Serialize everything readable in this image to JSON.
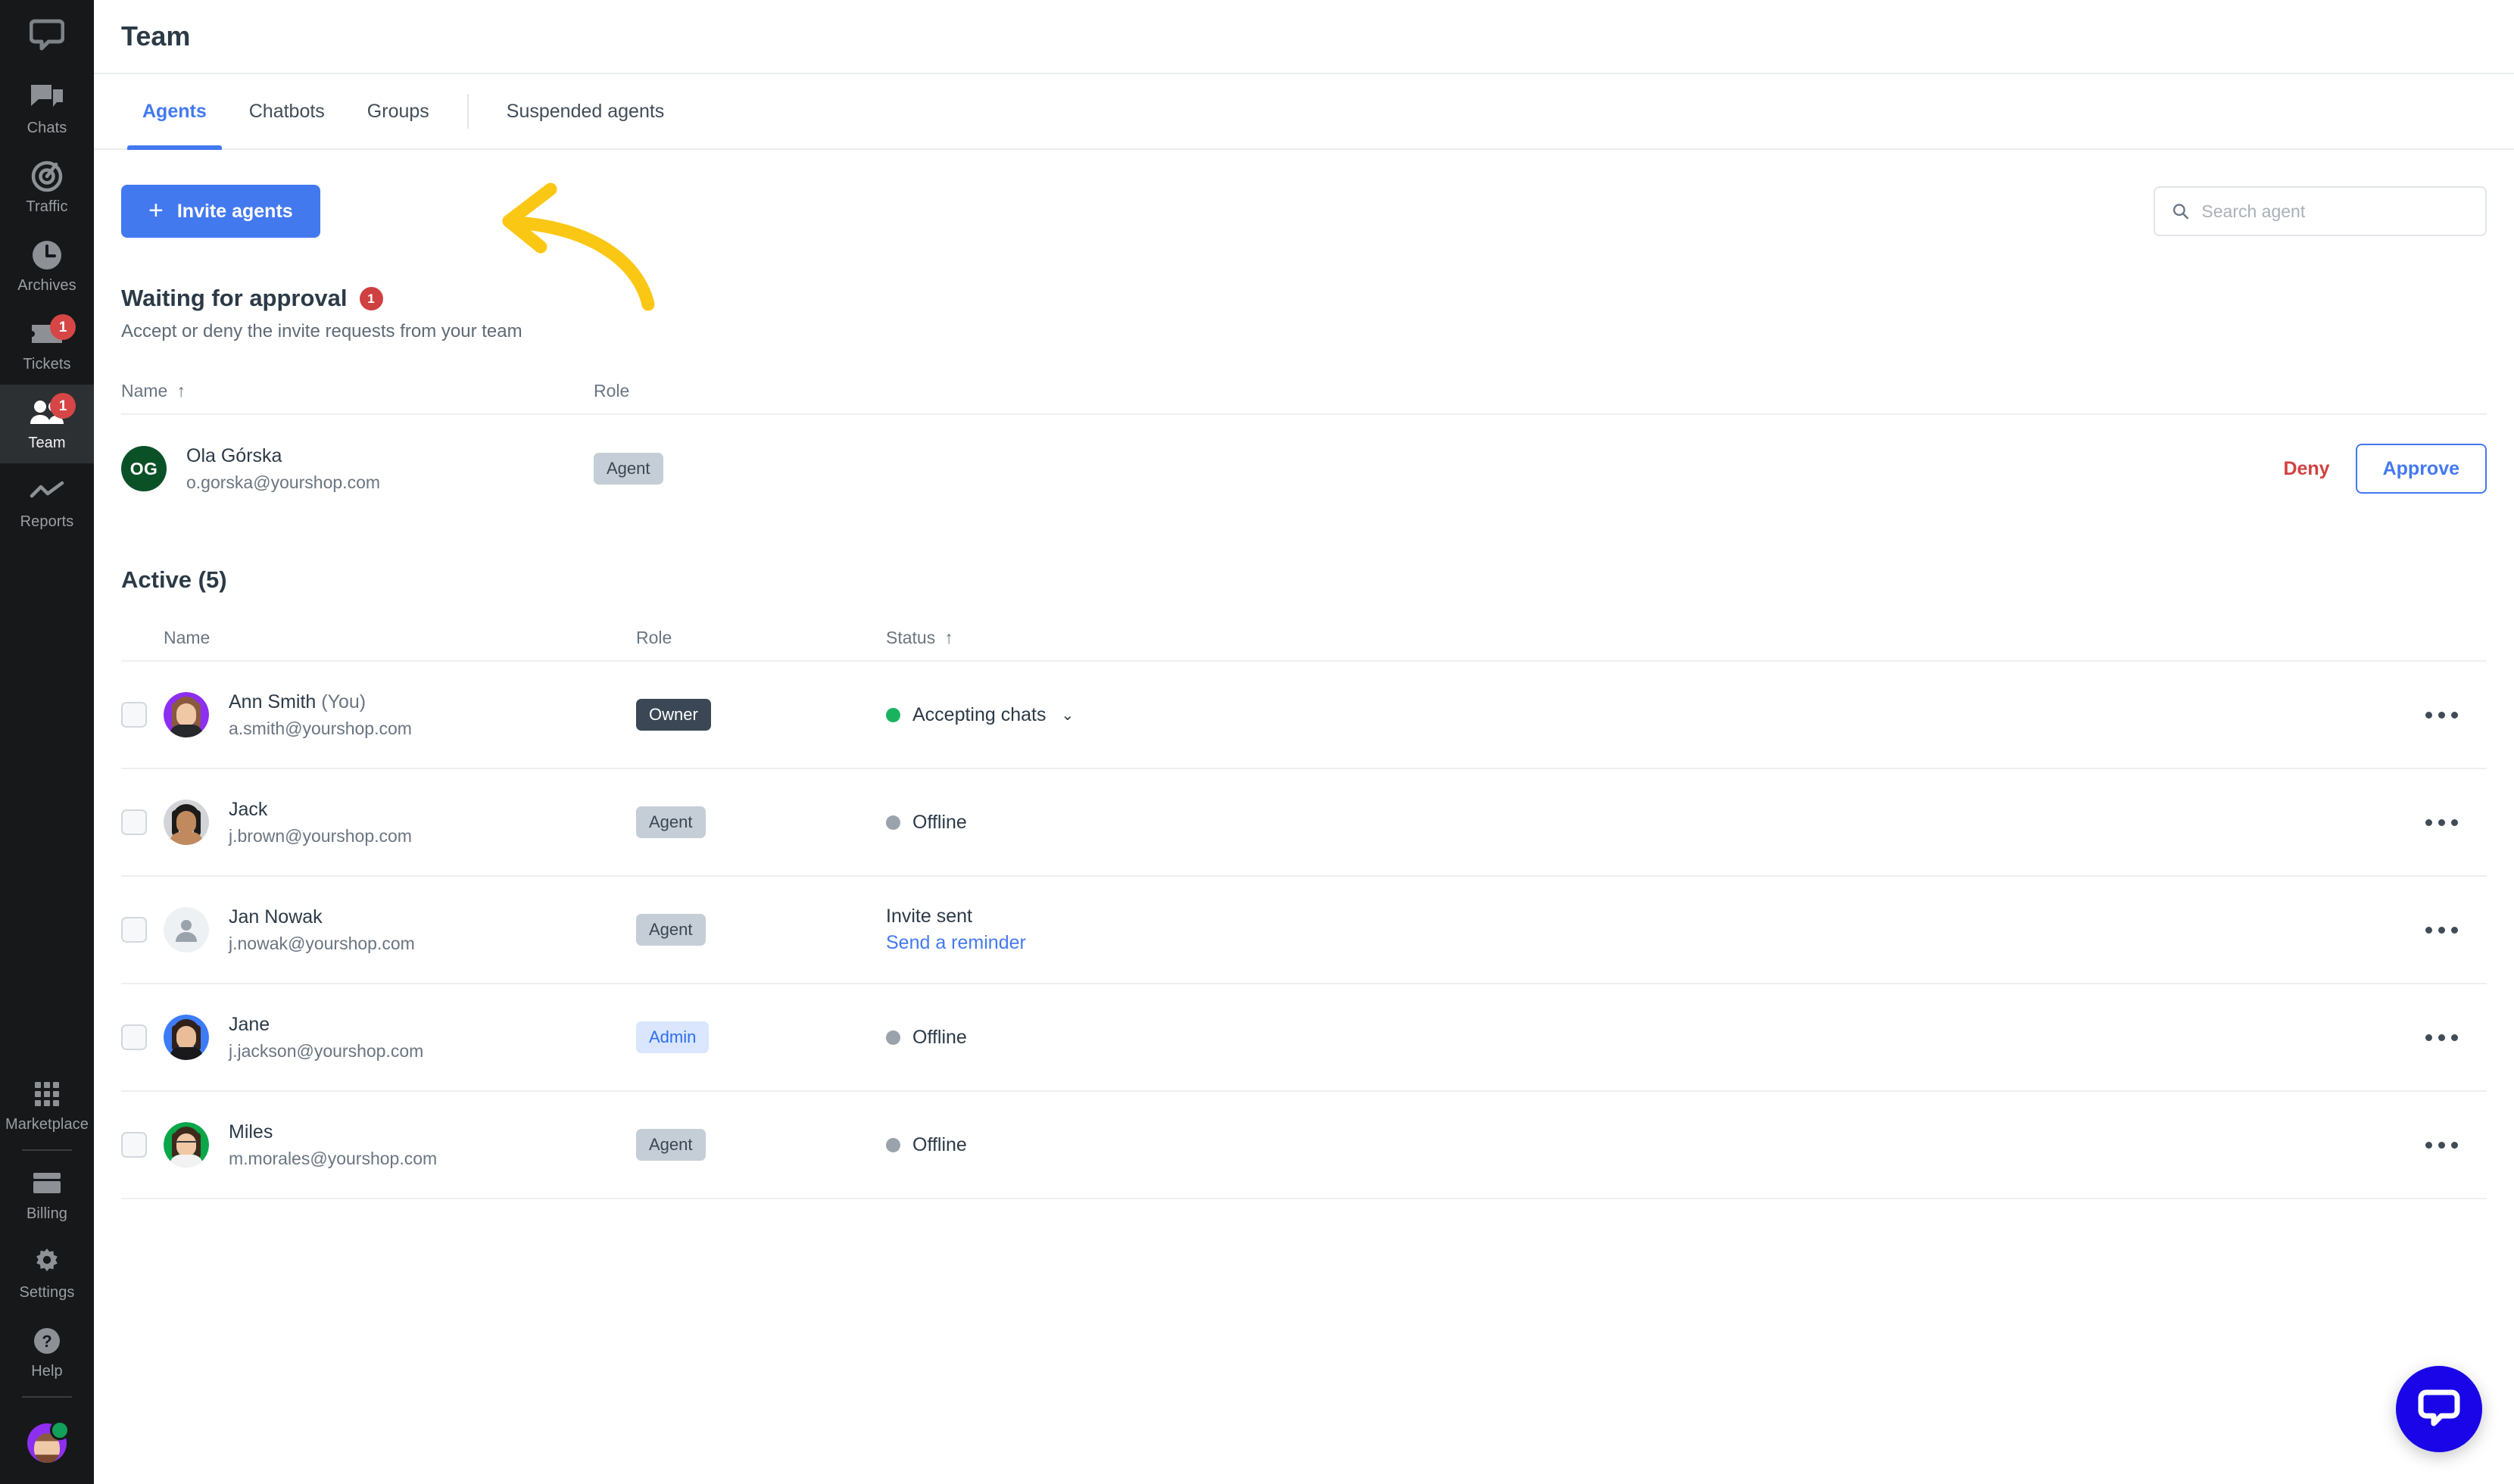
{
  "sidebar": {
    "logo_icon": "livechat-logo-icon",
    "items": [
      {
        "label": "Chats",
        "icon": "chats-icon",
        "badge": null,
        "active": false
      },
      {
        "label": "Traffic",
        "icon": "traffic-icon",
        "badge": null,
        "active": false
      },
      {
        "label": "Archives",
        "icon": "archives-icon",
        "badge": null,
        "active": false
      },
      {
        "label": "Tickets",
        "icon": "tickets-icon",
        "badge": "1",
        "active": false
      },
      {
        "label": "Team",
        "icon": "team-icon",
        "badge": "1",
        "active": true
      },
      {
        "label": "Reports",
        "icon": "reports-icon",
        "badge": null,
        "active": false
      }
    ],
    "bottom_items": [
      {
        "label": "Marketplace",
        "icon": "marketplace-icon"
      },
      {
        "label": "Billing",
        "icon": "billing-icon"
      },
      {
        "label": "Settings",
        "icon": "settings-gear-icon"
      },
      {
        "label": "Help",
        "icon": "help-question-icon"
      }
    ],
    "user_avatar": {
      "name": "user-avatar",
      "status": "online"
    }
  },
  "header": {
    "title": "Team"
  },
  "tabs": [
    {
      "label": "Agents",
      "active": true
    },
    {
      "label": "Chatbots",
      "active": false
    },
    {
      "label": "Groups",
      "active": false
    },
    {
      "label": "Suspended agents",
      "active": false
    }
  ],
  "toolbar": {
    "invite_label": "Invite agents",
    "invite_plus": "+"
  },
  "search": {
    "placeholder": "Search agent",
    "value": "",
    "icon": "search-icon"
  },
  "pending": {
    "title": "Waiting for approval",
    "count": "1",
    "subtitle": "Accept or deny the invite requests from your team",
    "columns": {
      "name": "Name",
      "role": "Role",
      "sort_arrow": "↑"
    },
    "rows": [
      {
        "initials": "OG",
        "name": "Ola Górska",
        "email": "o.gorska@yourshop.com",
        "role": "Agent",
        "deny_label": "Deny",
        "approve_label": "Approve"
      }
    ]
  },
  "active": {
    "title": "Active (5)",
    "columns": {
      "name": "Name",
      "role": "Role",
      "status": "Status",
      "sort_arrow": "↑"
    },
    "rows": [
      {
        "name": "Ann Smith",
        "you_suffix": "(You)",
        "email": "a.smith@yourshop.com",
        "role": "Owner",
        "role_style": "owner",
        "status": "Accepting chats",
        "status_dot": "green",
        "has_chevron": true,
        "link": null
      },
      {
        "name": "Jack",
        "you_suffix": "",
        "email": "j.brown@yourshop.com",
        "role": "Agent",
        "role_style": "agent",
        "status": "Offline",
        "status_dot": "gray",
        "has_chevron": false,
        "link": null
      },
      {
        "name": "Jan Nowak",
        "you_suffix": "",
        "email": "j.nowak@yourshop.com",
        "role": "Agent",
        "role_style": "agent",
        "status": "Invite sent",
        "status_dot": "none",
        "has_chevron": false,
        "link": "Send a reminder"
      },
      {
        "name": "Jane",
        "you_suffix": "",
        "email": "j.jackson@yourshop.com",
        "role": "Admin",
        "role_style": "admin",
        "status": "Offline",
        "status_dot": "gray",
        "has_chevron": false,
        "link": null
      },
      {
        "name": "Miles",
        "you_suffix": "",
        "email": "m.morales@yourshop.com",
        "role": "Agent",
        "role_style": "agent",
        "status": "Offline",
        "status_dot": "gray",
        "has_chevron": false,
        "link": null
      }
    ]
  },
  "chat_launcher": {
    "icon": "chat-bubble-icon"
  },
  "annotation": {
    "shape": "curved-arrow",
    "color": "#FBC715",
    "points_to": "invite-agents-button"
  },
  "colors": {
    "accent_blue": "#4379EF",
    "sidebar_bg": "#16181A",
    "badge_red": "#CF4040",
    "deny_red": "#D24040",
    "online_green": "#19B35F",
    "annotation_yellow": "#FBC715",
    "launcher_blue": "#1A04E8"
  }
}
